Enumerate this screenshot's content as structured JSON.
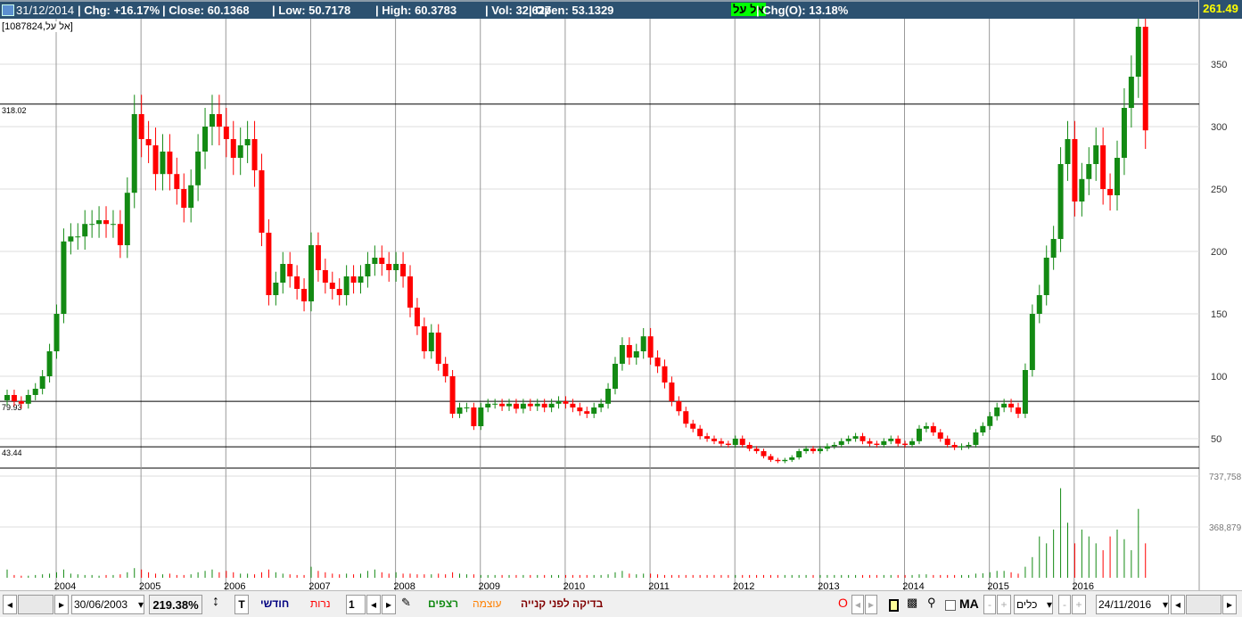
{
  "header": {
    "date": "31/12/2014",
    "chg": "| Chg: +16.17%",
    "close": "| Close: 60.1368",
    "low": "| Low: 50.7178",
    "high": "| High: 60.3783",
    "vol": "| Vol: 32,627",
    "open": "| Open: 53.1329",
    "badge": "אל על",
    "chg_open": "| Chg(O): 13.18%",
    "last_price": "261.49"
  },
  "symbol_label": "[אל על,1087824]",
  "colors": {
    "up": "#138a13",
    "down": "#ff0000",
    "header": "#2c5170"
  },
  "chart_data": {
    "type": "candlestick",
    "interval": "monthly",
    "start": "2003-06",
    "y_ticks": [
      50,
      100,
      150,
      200,
      250,
      300,
      350
    ],
    "h_lines": [
      {
        "value": 318.02,
        "label": "318.02"
      },
      {
        "value": 79.93,
        "label": "79.93"
      },
      {
        "value": 43.44,
        "label": "43.44"
      }
    ],
    "volume_ticks": [
      {
        "value": 737758,
        "label": "737,758"
      },
      {
        "value": 368879,
        "label": "368,879"
      }
    ],
    "years": [
      "2004",
      "2005",
      "2006",
      "2007",
      "2008",
      "2009",
      "2010",
      "2011",
      "2012",
      "2013",
      "2014",
      "2015",
      "2016"
    ],
    "close": [
      85,
      80,
      78,
      85,
      90,
      100,
      120,
      150,
      208,
      212,
      212,
      222,
      222,
      225,
      222,
      222,
      205,
      247,
      310,
      290,
      285,
      262,
      280,
      262,
      250,
      235,
      253,
      280,
      300,
      310,
      300,
      290,
      275,
      285,
      290,
      265,
      215,
      165,
      175,
      190,
      180,
      170,
      160,
      205,
      185,
      175,
      170,
      165,
      180,
      175,
      180,
      190,
      195,
      190,
      185,
      190,
      180,
      155,
      140,
      120,
      135,
      110,
      100,
      70,
      75,
      75,
      60,
      75,
      78,
      78,
      76,
      78,
      74,
      78,
      76,
      78,
      75,
      78,
      80,
      78,
      75,
      72,
      70,
      75,
      78,
      90,
      110,
      125,
      115,
      120,
      132,
      115,
      108,
      95,
      80,
      72,
      62,
      58,
      52,
      50,
      48,
      46,
      45,
      50,
      45,
      42,
      40,
      36,
      33,
      32,
      33,
      35,
      40,
      42,
      40,
      42,
      44,
      45,
      48,
      50,
      52,
      48,
      46,
      45,
      48,
      50,
      46,
      45,
      48,
      58,
      60,
      55,
      50,
      45,
      43,
      44,
      45,
      55,
      60.14,
      68,
      75,
      78,
      75,
      70,
      105,
      150,
      165,
      195,
      210,
      270,
      290,
      240,
      258,
      270,
      285,
      250,
      245,
      275,
      315,
      340,
      380,
      297
    ],
    "volume_k": [
      60,
      20,
      15,
      15,
      20,
      25,
      30,
      40,
      60,
      30,
      25,
      20,
      20,
      15,
      20,
      20,
      25,
      40,
      70,
      60,
      40,
      30,
      25,
      30,
      20,
      20,
      25,
      40,
      50,
      60,
      40,
      50,
      40,
      30,
      30,
      25,
      40,
      60,
      40,
      30,
      25,
      20,
      20,
      80,
      50,
      40,
      30,
      25,
      30,
      25,
      30,
      50,
      60,
      40,
      30,
      40,
      30,
      30,
      25,
      25,
      25,
      30,
      25,
      40,
      30,
      25,
      25,
      20,
      20,
      20,
      20,
      20,
      20,
      20,
      20,
      20,
      20,
      20,
      20,
      20,
      20,
      20,
      20,
      20,
      20,
      25,
      40,
      50,
      30,
      25,
      30,
      30,
      25,
      20,
      20,
      20,
      20,
      20,
      20,
      20,
      20,
      20,
      20,
      20,
      20,
      20,
      20,
      20,
      20,
      20,
      20,
      20,
      20,
      20,
      20,
      20,
      20,
      20,
      20,
      20,
      20,
      20,
      20,
      20,
      20,
      20,
      20,
      20,
      20,
      25,
      25,
      20,
      20,
      20,
      20,
      20,
      20,
      30,
      32.6,
      40,
      50,
      50,
      40,
      30,
      80,
      150,
      300,
      250,
      350,
      650,
      400,
      250,
      350,
      300,
      250,
      200,
      300,
      350,
      280,
      200,
      500,
      250
    ]
  },
  "toolbar": {
    "start_date": "30/06/2003",
    "zoom": "219.38%",
    "text_tool": "T",
    "monthly": "חודשי",
    "candles": "נרות",
    "step": "1",
    "continuous": "רצפים",
    "strength": "עוצמה",
    "pre_buy_check": "בדיקה לפני קנייה",
    "o_label": "O",
    "ma_label": "MA",
    "tools": "כלים",
    "end_date": "24/11/2016"
  }
}
